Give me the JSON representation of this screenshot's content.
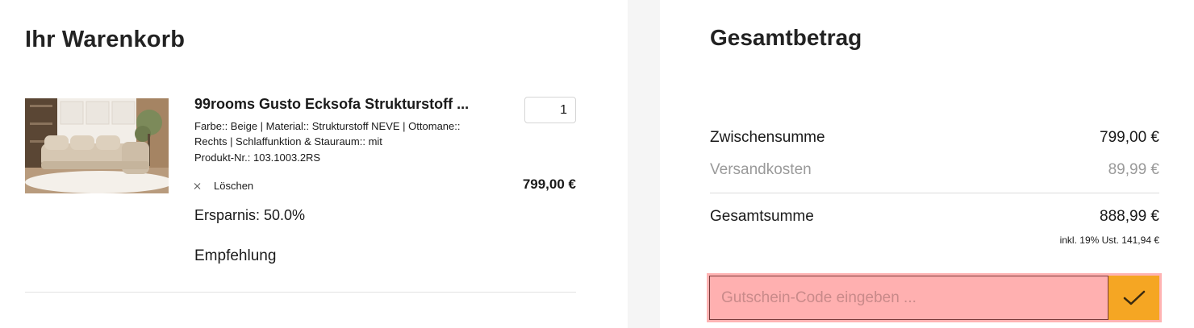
{
  "cart": {
    "title": "Ihr Warenkorb",
    "item": {
      "name": "99rooms Gusto Ecksofa Strukturstoff ...",
      "variant": "Farbe:: Beige | Material:: Strukturstoff NEVE | Ottomane:: Rechts | Schlaffunktion & Stauraum:: mit",
      "product_number_label": "Produkt-Nr.:",
      "product_number": "103.1003.2RS",
      "quantity": "1",
      "remove_label": "Löschen",
      "price": "799,00 €",
      "savings": "Ersparnis: 50.0%",
      "recommendation": "Empfehlung",
      "image_icon": "sofa-product-photo"
    }
  },
  "summary": {
    "title": "Gesamtbetrag",
    "subtotal_label": "Zwischensumme",
    "subtotal_value": "799,00 €",
    "shipping_label": "Versandkosten",
    "shipping_value": "89,99 €",
    "total_label": "Gesamtsumme",
    "total_value": "888,99 €",
    "tax_note": "inkl. 19% Ust. 141,94 €",
    "coupon": {
      "placeholder": "Gutschein-Code eingeben ...",
      "submit_icon": "check-icon"
    }
  },
  "colors": {
    "accent": "#f5a623",
    "coupon_highlight": "#ffb3b3",
    "muted_text": "#9a9a9a"
  }
}
